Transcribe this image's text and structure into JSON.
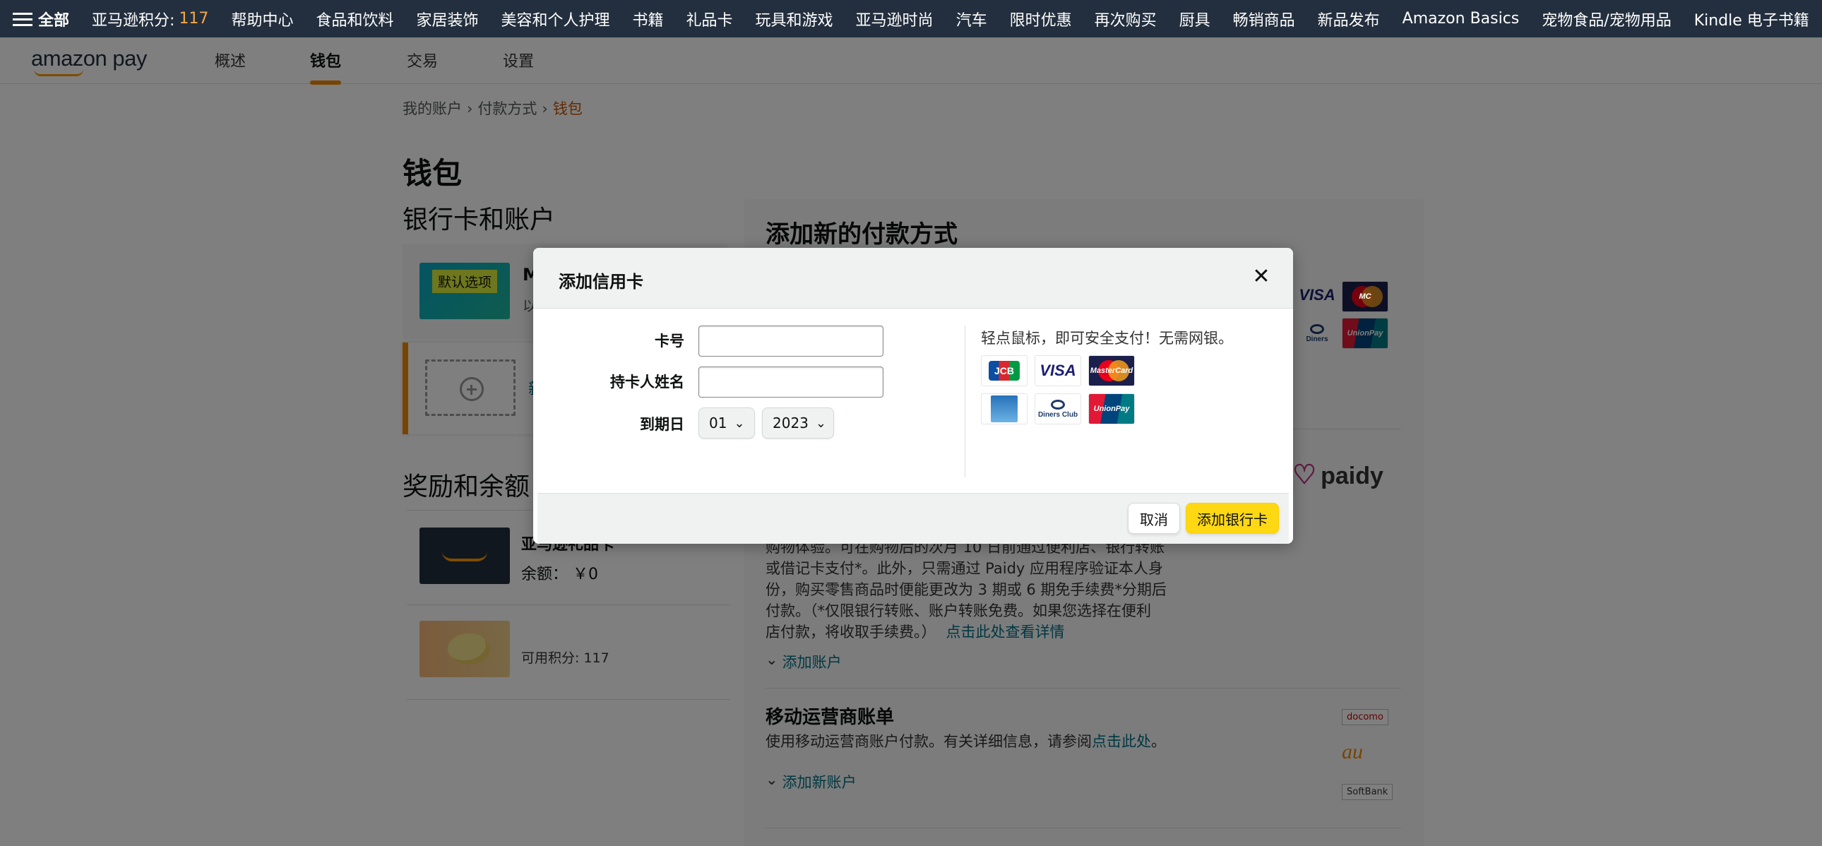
{
  "topnav": {
    "all_label": "全部",
    "points_label": "亚马逊积分:",
    "points_value": "117",
    "items": [
      "帮助中心",
      "食品和饮料",
      "家居装饰",
      "美容和个人护理",
      "书籍",
      "礼品卡",
      "玩具和游戏",
      "亚马逊时尚",
      "汽车",
      "限时优惠",
      "再次购买",
      "厨具",
      "畅销商品",
      "新品发布",
      "Amazon Basics",
      "宠物食品/宠物用品",
      "Kindle 电子书籍"
    ]
  },
  "subnav": {
    "logo": "amazon pay",
    "tabs": [
      "概述",
      "钱包",
      "交易",
      "设置"
    ],
    "active_tab": "钱包"
  },
  "breadcrumb": [
    "我的账户",
    "付款方式",
    "钱包"
  ],
  "page_title": "钱包",
  "section_cards": "银行卡和账户",
  "card1": {
    "tag": "默认选项",
    "name": "M",
    "sub": "以"
  },
  "card2": {
    "new": "新"
  },
  "section_rewards": "奖励和余额",
  "rewards": [
    {
      "title": "亚马逊礼品卡",
      "detail": "余额： ￥0"
    },
    {
      "title": "",
      "detail": "可用积分: 117"
    }
  ],
  "right_panel": {
    "title": "添加新的付款方式",
    "paidy_logo": "paidy",
    "paidy_text_lines": [
      "购物体验。可在购物后的次月 10 日前通过便利店、银行转账",
      "或借记卡支付*。此外，只需通过 Paidy 应用程序验证本人身",
      "份，购买零售商品时便能更改为 3 期或 6 期免手续费*分期后",
      "付款。（*仅限银行转账、账户转账免费。如果您选择在便利",
      "店付款，将收取手续费。）"
    ],
    "paidy_link": "点击此处查看详情",
    "paidy_add": "添加账户",
    "mobile_title": "移动运营商账单",
    "mobile_desc": "使用移动运营商账户付款。有关详细信息，请参阅",
    "mobile_desc_link": "点击此处",
    "mobile_desc_end": "。",
    "mobile_add": "添加新账户",
    "carriers": [
      "docomo",
      "au",
      "SoftBank"
    ]
  },
  "modal": {
    "title": "添加信用卡",
    "close_icon": "close-icon",
    "card_number_label": "卡号",
    "card_number_value": "",
    "holder_label": "持卡人姓名",
    "holder_value": "",
    "expiry_label": "到期日",
    "expiry_month": "01",
    "expiry_year": "2023",
    "tip": "轻点鼠标，即可安全支付！无需网银。",
    "card_brands": [
      "JCB",
      "VISA",
      "MasterCard",
      "AMEX",
      "Diners Club",
      "UnionPay"
    ],
    "cancel_label": "取消",
    "submit_label": "添加银行卡"
  },
  "colors": {
    "nav_bg": "#232f3e",
    "accent": "#f08804",
    "link": "#007185",
    "button_primary": "#ffd814"
  }
}
